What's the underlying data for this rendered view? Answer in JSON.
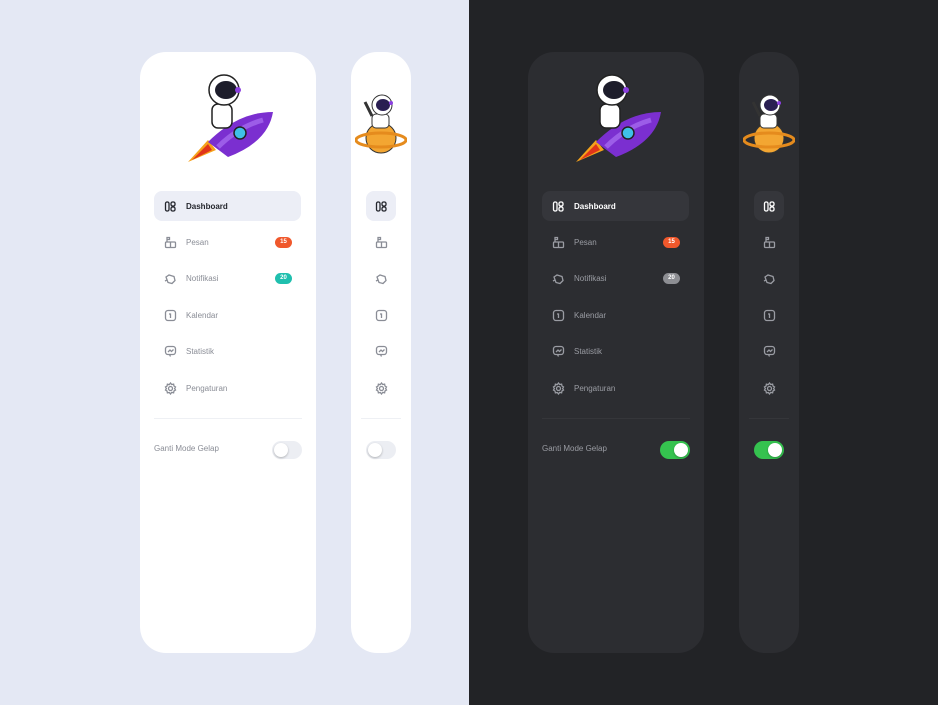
{
  "nav": [
    {
      "label": "Dashboard",
      "icon": "dashboard-icon",
      "active": true
    },
    {
      "label": "Pesan",
      "icon": "message-icon",
      "badge": "15"
    },
    {
      "label": "Notifikasi",
      "icon": "bell-icon",
      "badge": "20"
    },
    {
      "label": "Kalendar",
      "icon": "calendar-icon"
    },
    {
      "label": "Statistik",
      "icon": "chart-icon"
    },
    {
      "label": "Pengaturan",
      "icon": "gear-icon"
    }
  ],
  "dark_mode_label": "Ganti Mode Gelap",
  "themes": {
    "light": {
      "dark_mode_on": false,
      "badge_colors": {
        "Pesan": "#f0582c",
        "Notifikasi": "#1fbfae"
      }
    },
    "dark": {
      "dark_mode_on": true,
      "badge_colors": {
        "Pesan": "#f0582c",
        "Notifikasi": "#8d8e93"
      }
    }
  },
  "colors": {
    "toggle_on": "#35c24f",
    "light_bg": "#e4e8f4",
    "dark_bg": "#222326"
  }
}
